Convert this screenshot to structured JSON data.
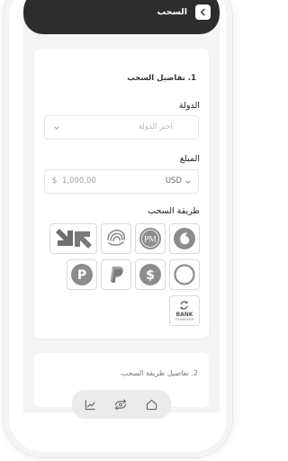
{
  "header": {
    "title": "السحب",
    "back_icon": "chevron-left-icon"
  },
  "details": {
    "section_title": "1.  تفاصيل السحب",
    "country": {
      "label": "الدولة",
      "placeholder": "اختر الدولة"
    },
    "amount": {
      "label": "المبلغ",
      "currency_symbol": "$",
      "value": "1,000.00",
      "currency": "USD"
    },
    "methods": {
      "label": "طريقة السحب",
      "items": [
        {
          "name": "transfer-arrows",
          "icon": "arrows-icon"
        },
        {
          "name": "swirl",
          "icon": "swirl-icon"
        },
        {
          "name": "perfect-money",
          "icon": "pm-icon",
          "text": "PM"
        },
        {
          "name": "vodafone",
          "icon": "vodafone-icon"
        },
        {
          "name": "payoneer-p",
          "icon": "p-circle-icon",
          "text": "P"
        },
        {
          "name": "paypal",
          "icon": "paypal-icon"
        },
        {
          "name": "dollar",
          "icon": "dollar-icon",
          "text": "$"
        },
        {
          "name": "ring",
          "icon": "ring-icon"
        },
        {
          "name": "bank-transfer",
          "icon": "bank-transfer-icon",
          "text": "BANK",
          "subtext": "TRANSFER"
        }
      ]
    }
  },
  "method_details": {
    "title": "2.  تفاصيل طريقة السحب"
  },
  "navbar": {
    "items": [
      {
        "name": "chart",
        "icon": "chart-icon"
      },
      {
        "name": "exchange",
        "icon": "cash-exchange-icon"
      },
      {
        "name": "home",
        "icon": "home-icon"
      }
    ]
  },
  "colors": {
    "header_bg": "#2d2d2d",
    "screen_bg": "#f4f4f4",
    "icon_gray": "#8c8c8c"
  }
}
